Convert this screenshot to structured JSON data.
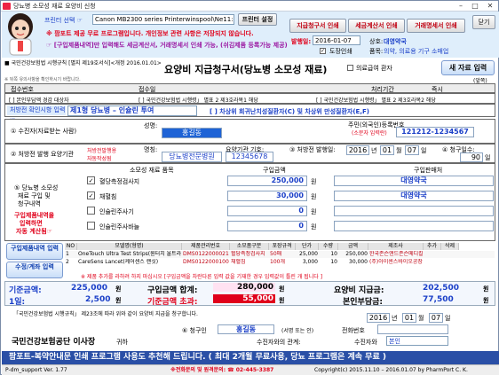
{
  "window": {
    "title": "당뇨병 소모성 재료 요양비 신청",
    "min": "–",
    "max": "□",
    "close": "✕"
  },
  "top": {
    "printer_label": "프린터 선택 ☞",
    "printer_value": "Canon MB2300 series Printerwinspool\\Ne11:",
    "printer_setup": "프린터 설정",
    "btn_print_claim": "지급청구서 인쇄",
    "btn_print_tax": "세금계산서 인쇄",
    "btn_print_trade": "거래명세서 인쇄",
    "btn_close": "닫기",
    "notice1": "※ 팜포트 제공 무료 프로그램입니다. 개인정보 관련 사항은 저장되지 않습니다.",
    "notice2": "☞ [구입제품내역]만 입력해도 세금계산서, 거래명세서 인쇄 가능, (쉬김제품 등록가능 제공)",
    "issue_date_label": "발행일:",
    "issue_date": "2016-01-07",
    "stamp_label": "도장인쇄",
    "pharm_label": "상호:",
    "pharm_name": "대영약국",
    "item_label": "품목:",
    "item_value": "의약, 의료용 기구 소매업"
  },
  "form": {
    "agency": "■ 국민건강보험법 시행규칙 [별지 제19호서식]<개정 2016.01.01>",
    "title": "요양비 지급청구서(당뇨병 소모성 재료)",
    "medical_aid": "의료급여 환자",
    "new_input": "새 자료 입력",
    "note": "※ 뒤쪽 유의사항을 확인하시기 바랍니다.",
    "page": "(앞쪽)",
    "receipt_no": "접수번호",
    "receipt_date": "접수일",
    "process_period": "처리기간",
    "process_value": "즉시",
    "opt1": "[  ] 본인부담액 경감 대상자",
    "opt2": "[  ] 국민건강보험법 시행령」 별표 2 제3호라목1 해당",
    "opt3": "[  ] 국민건강보험법 시행령」 별표 2 제3호라목2 해당",
    "type_label": "처방전 확인시항 입력 ☞",
    "type_value": "제1형 당뇨병 – 인슐린 투여",
    "type_note": "[ ] 차상위 희귀난치성질환자(C) 및 차상위 만성질환자(E,F)"
  },
  "claimant": {
    "sec_label": "① 수진자(자료받는 사람)",
    "name_label": "성명:",
    "name": "홍길동",
    "rrn_label": "주민(외국인)등록번호",
    "rrn_hint": "(소문자 입력란)",
    "rrn": "121212-1234567"
  },
  "prescriber": {
    "sec_label": "② 처방전 발행 요양기관",
    "hint1": "처방전발행용",
    "hint2": "자동작성됨",
    "inst_label": "명칭:",
    "inst_name": "당뇨병전문병원",
    "code_label": "요양기관 기호:",
    "code": "12345678",
    "date_label": "③ 처방전 발행일:",
    "y": "2016",
    "ylbl": "년",
    "m": "01",
    "mlbl": "월",
    "d": "07",
    "dlbl": "일",
    "req_label": "④ 청구일수:",
    "req_days": "90",
    "req_unit": "일"
  },
  "purchase": {
    "col_item": "소모성 재료 품목",
    "col_amount": "구입금액",
    "col_seller": "구입판매처",
    "left1": "⑤ 당뇨병 소모성",
    "left2": "재료 구입 및",
    "left3": "청구내역",
    "left4": "구입제품내역을",
    "left5": "입력하면",
    "left6": "자동 계산됨☞",
    "rows": [
      {
        "chk": "✓",
        "name": "혈당측정검사지",
        "amount": "250,000",
        "unit": "원",
        "seller": "대영약국"
      },
      {
        "chk": "✓",
        "name": "채혈침",
        "amount": "30,000",
        "unit": "원",
        "seller": "대영약국"
      },
      {
        "chk": "",
        "name": "인슐린주사기",
        "amount": "0",
        "unit": "원",
        "seller": ""
      },
      {
        "chk": "",
        "name": "인슐린주사바늘",
        "amount": "0",
        "unit": "원",
        "seller": ""
      }
    ]
  },
  "products": {
    "btn_input": "구입제품내역 입력",
    "btn_modify": "수정/계좌 입력",
    "headers": [
      "NO",
      "모델명(형명)",
      "제품관리번호",
      "소모품구분",
      "포장규격",
      "단가",
      "수량",
      "금액",
      "제조사",
      "추가",
      "삭제"
    ],
    "rows": [
      {
        "no": "1",
        "model": "OneTouch Ultra Test Strips(원터치 울트라)",
        "code": "DMS0122000021",
        "kind": "혈당측정검사지",
        "pack": "50매",
        "price": "25,000",
        "qty": "10",
        "amt": "250,000",
        "maker": "한국존슨앤드존슨메디칼"
      },
      {
        "no": "2",
        "model": "CareSens Lancet(케어센스 랜싯)",
        "code": "DMS0122000100",
        "kind": "채혈침",
        "pack": "100개",
        "price": "3,000",
        "qty": "10",
        "amt": "30,000",
        "maker": "(주)아이센스바이오공장"
      }
    ],
    "warn": "※ 제품 추가를 라하려 하지 마십시오 [구입금액을 차란다른 입력 값을 기재한 경우 입력값이 틀린 개 됩니다 ]"
  },
  "summary": {
    "std_label": "기준금액:",
    "std_val": "225,000",
    "won": "원",
    "total_label": "구입금액 합계:",
    "total_val": "280,000",
    "claim_label": "요양비 지급금:",
    "claim_val": "202,500",
    "day_label": "1일:",
    "day_val": "2,500",
    "limit_label": "기준금액 초과:",
    "limit_val": "55,000",
    "self_label": "본인부담금:",
    "self_val": "77,500"
  },
  "sign": {
    "text1": "「국민건강보험법 시행규칙」 제23조에 따라 위와 같이 요양비 지급을 청구합니다.",
    "y": "2016",
    "ylbl": "년",
    "m": "01",
    "mlbl": "월",
    "d": "07",
    "dlbl": "일",
    "claimant_label": "⑥ 청구인",
    "claimant_name": "홍길동",
    "sign_hint": "(서명 또는 인)",
    "phone_label": "전화번호",
    "rel_label": "수진자와의 관계:",
    "rel2_label": "수진자와",
    "rel_value": "본인",
    "to": "국민건강보험공단 이사장",
    "honor": "귀하"
  },
  "banner": {
    "text": "팜포트-복약안내문 인쇄 프로그램 사용도 추천해 드립니다. ( 최대 2개월 무료사용, 당뇨 프로그램은 계속 무료 )"
  },
  "status": {
    "left": "P-dm_support Ver. 1.77",
    "center": "※전화문의 및 원격문의: ☎ 02-445-3387",
    "right": "Copyright(c) 2015.11.10 – 2016.01.07  by PharmPort C. K."
  },
  "colors": {
    "accent": "#1e63d6",
    "red": "#e0001a",
    "banner": "#2a4fa6"
  }
}
